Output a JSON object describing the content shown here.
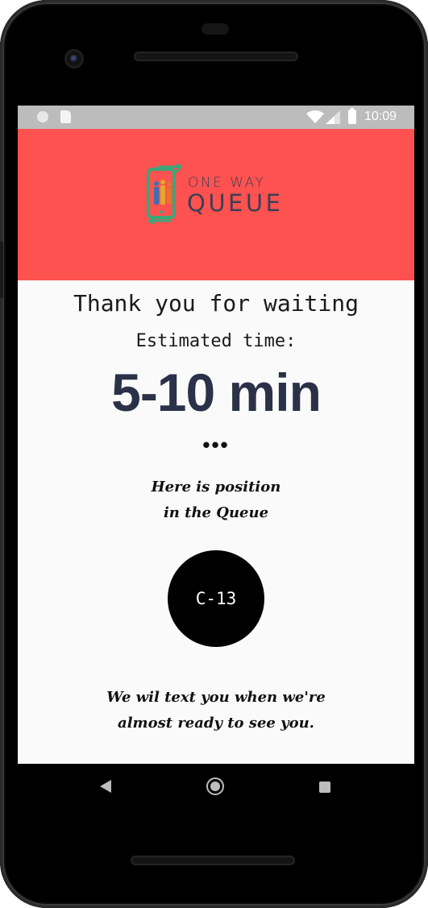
{
  "status_bar": {
    "time": "10:09",
    "icons": [
      "notification-dot-icon",
      "sd-card-icon",
      "wifi-icon",
      "cell-signal-icon",
      "battery-icon"
    ]
  },
  "header": {
    "background_color": "#fe5250",
    "logo": {
      "line1": "ONE WAY",
      "line2": "QUEUE",
      "icon": "phone-with-people-arrows-icon",
      "text_color": "#3a3f55"
    }
  },
  "main": {
    "heading": "Thank you for waiting",
    "estimated_label": "Estimated time:",
    "estimated_value": "5-10 min",
    "estimated_color": "#2a3148",
    "ellipsis": "•••",
    "position_caption": [
      "Here is position",
      "in the Queue"
    ],
    "ticket_number": "C-13",
    "notice": [
      "We wil text you when we're",
      "almost ready to see you."
    ]
  },
  "nav_bar": {
    "buttons": [
      "back-icon",
      "home-icon",
      "recents-icon"
    ]
  }
}
